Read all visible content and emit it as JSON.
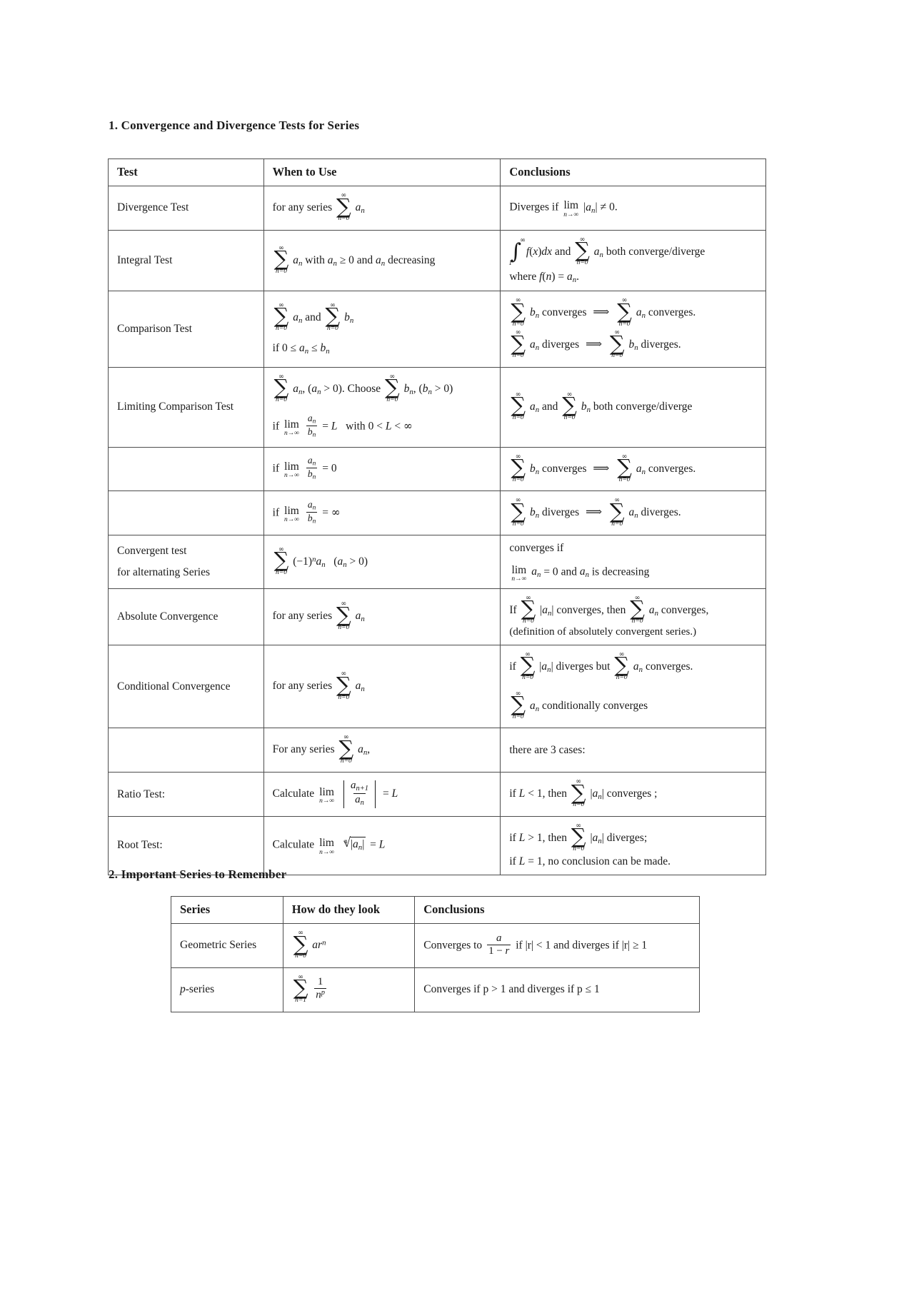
{
  "document": {
    "section1_heading": "1. Convergence and Divergence Tests for Series",
    "section2_heading": "2. Important Series to Remember"
  },
  "tests_table": {
    "headers": {
      "test": "Test",
      "when_to_use": "When to Use",
      "conclusions": "Conclusions"
    },
    "rows": [
      {
        "test": "Divergence Test",
        "when": "for any series ∑(n=0..∞) aₙ",
        "conclusion": "Diverges if lim(n→∞) |aₙ| ≠ 0."
      },
      {
        "test": "Integral Test",
        "when": "∑(n=0..∞) aₙ with aₙ ≥ 0 and aₙ decreasing",
        "conclusion": "∫(1..∞) f(x)dx and ∑(n=0..∞) aₙ both converge/diverge where f(n) = aₙ."
      },
      {
        "test": "Comparison Test",
        "when": "∑(n=0..∞) aₙ and ∑(n=0..∞) bₙ, if 0 ≤ aₙ ≤ bₙ",
        "conclusion": "∑ bₙ converges ⟹ ∑ aₙ converges. ∑ aₙ diverges ⟹ ∑ bₙ diverges."
      },
      {
        "test": "Limiting Comparison Test",
        "when": "∑(n=0..∞) aₙ, (aₙ > 0). Choose ∑(n=0..∞) bₙ, (bₙ > 0); if lim(n→∞) aₙ/bₙ = L with 0 < L < ∞",
        "conclusion": "∑ aₙ and ∑ bₙ both converge/diverge"
      },
      {
        "test": "",
        "when": "if lim(n→∞) aₙ/bₙ = 0",
        "conclusion": "∑ bₙ converges ⟹ ∑ aₙ converges."
      },
      {
        "test": "",
        "when": "if lim(n→∞) aₙ/bₙ = ∞",
        "conclusion": "∑ bₙ diverges ⟹ ∑ aₙ diverges."
      },
      {
        "test": "Convergent test for alternating Series",
        "when": "∑(n=0..∞) (−1)ⁿ aₙ  (aₙ > 0)",
        "conclusion": "converges if lim(n→∞) aₙ = 0 and aₙ is decreasing"
      },
      {
        "test": "Absolute Convergence",
        "when": "for any series ∑(n=0..∞) aₙ",
        "conclusion": "If ∑ |aₙ| converges, then ∑ aₙ converges, (definition of absolutely convergent series.)"
      },
      {
        "test": "Conditional Convergence",
        "when": "for any series ∑(n=0..∞) aₙ",
        "conclusion": "if ∑ |aₙ| diverges but ∑ aₙ converges. ∑ aₙ conditionally converges"
      },
      {
        "test": "Ratio Test / Root Test",
        "when": "For any series ∑(n=0..∞) aₙ, Calculate lim(n→∞) |aₙ₊₁/aₙ| = L ; Calculate lim(n→∞) ⁿ√|aₙ| = L",
        "conclusion": "there are 3 cases: if L < 1, then ∑ |aₙ| converges ; if L > 1, then ∑ |aₙ| diverges; if L = 1, no conclusion can be made."
      }
    ],
    "labels": {
      "divergence_test": "Divergence Test",
      "integral_test": "Integral Test",
      "comparison_test": "Comparison Test",
      "limiting_comparison_test": "Limiting Comparison Test",
      "convergent_test": "Convergent test",
      "for_alternating_series": "for alternating Series",
      "absolute_convergence": "Absolute Convergence",
      "conditional_convergence": "Conditional Convergence",
      "ratio_test": "Ratio Test:",
      "root_test": "Root Test:"
    },
    "text": {
      "for_any_series": "for any series",
      "diverges_if": "Diverges if",
      "with": "with",
      "and": "and",
      "decreasing": "decreasing",
      "both_converge_diverge": "both converge/diverge",
      "where": "where",
      "converges": "converges",
      "converges_period": "converges.",
      "diverges_period": "diverges.",
      "diverges": "diverges",
      "if": "if",
      "choose": "Choose",
      "converges_if": "converges if",
      "is_decreasing": "is decreasing",
      "if_cap": "If",
      "converges_comma": "converges,",
      "then": "then",
      "definition_note": "(definition of absolutely convergent series.)",
      "diverges_but": "diverges but",
      "conditionally_converges": "conditionally converges",
      "for_any_series_cap": "For any series",
      "calculate": "Calculate",
      "three_cases": "there are 3 cases:",
      "converges_semicolon": "converges ;",
      "diverges_semicolon": "diverges;",
      "no_conclusion": "no conclusion can be made."
    }
  },
  "series_table": {
    "headers": {
      "series": "Series",
      "how_look": "How do they look",
      "conclusions": "Conclusions"
    },
    "rows": [
      {
        "name": "Geometric Series",
        "form": "∑(n=0..∞) arⁿ",
        "conclusion": "Converges to a/(1−r) if |r| < 1 and diverges if |r| ≥ 1"
      },
      {
        "name": "p-series",
        "form": "∑(n=1..∞) 1/nᵖ",
        "conclusion": "Converges if p > 1 and diverges if p ≤ 1"
      }
    ],
    "text": {
      "converges_to": "Converges to",
      "if_abs_r_lt1": "if |r| < 1 and diverges if |r| ≥ 1",
      "converges_if_p": "Converges if p > 1 and diverges if p ≤ 1"
    }
  },
  "symbols": {
    "infinity": "∞",
    "sigma": "∑",
    "integral": "∫",
    "implies": "⟹",
    "not_equal": "≠",
    "leq": "≤",
    "geq": "≥",
    "lower_limit_n0": "n=0",
    "lower_limit_n1": "n=1",
    "lower_limit_one": "1",
    "n_to_inf": "n→∞",
    "lim": "lim"
  }
}
